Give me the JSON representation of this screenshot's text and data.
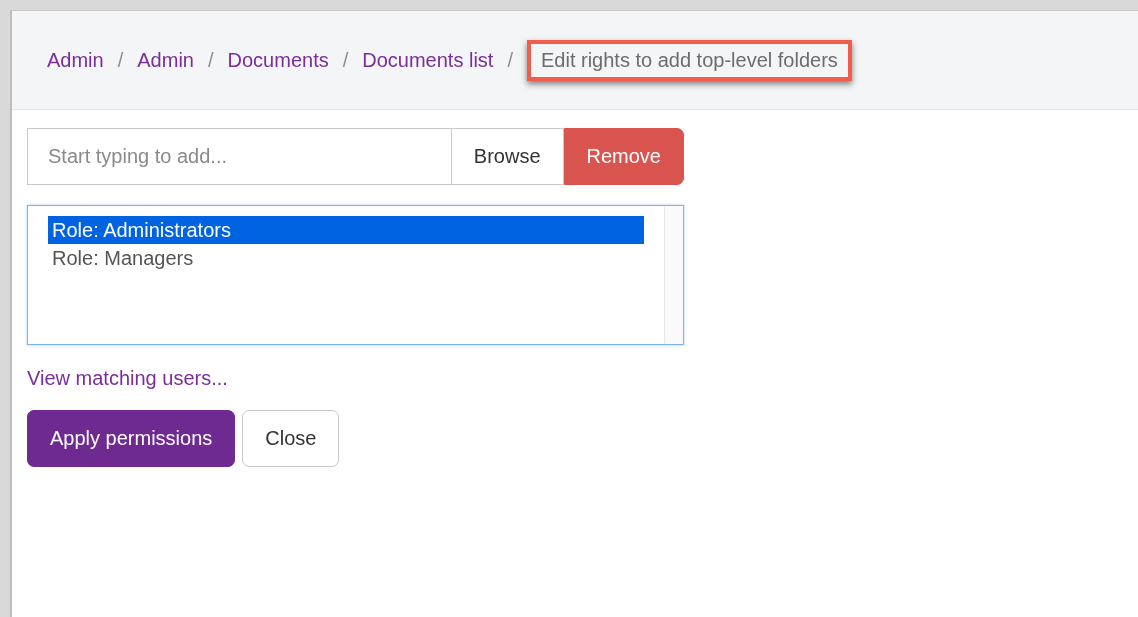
{
  "breadcrumb": [
    {
      "label": "Admin",
      "current": false,
      "highlighted": false
    },
    {
      "label": "Admin",
      "current": false,
      "highlighted": false
    },
    {
      "label": "Documents",
      "current": false,
      "highlighted": false
    },
    {
      "label": "Documents list",
      "current": false,
      "highlighted": false
    },
    {
      "label": "Edit rights to add top-level folders",
      "current": true,
      "highlighted": true
    }
  ],
  "breadcrumb_separator": "/",
  "search": {
    "placeholder": "Start typing to add..."
  },
  "buttons": [
    {
      "label": "Browse",
      "kind": "default"
    },
    {
      "label": "Remove",
      "kind": "danger"
    }
  ],
  "list": [
    {
      "label": "Role: Administrators",
      "selected": true
    },
    {
      "label": "Role: Managers",
      "selected": false
    }
  ],
  "link": "View matching users...",
  "actions": [
    {
      "label": "Apply permissions",
      "kind": "primary"
    },
    {
      "label": "Close",
      "kind": "default"
    }
  ]
}
